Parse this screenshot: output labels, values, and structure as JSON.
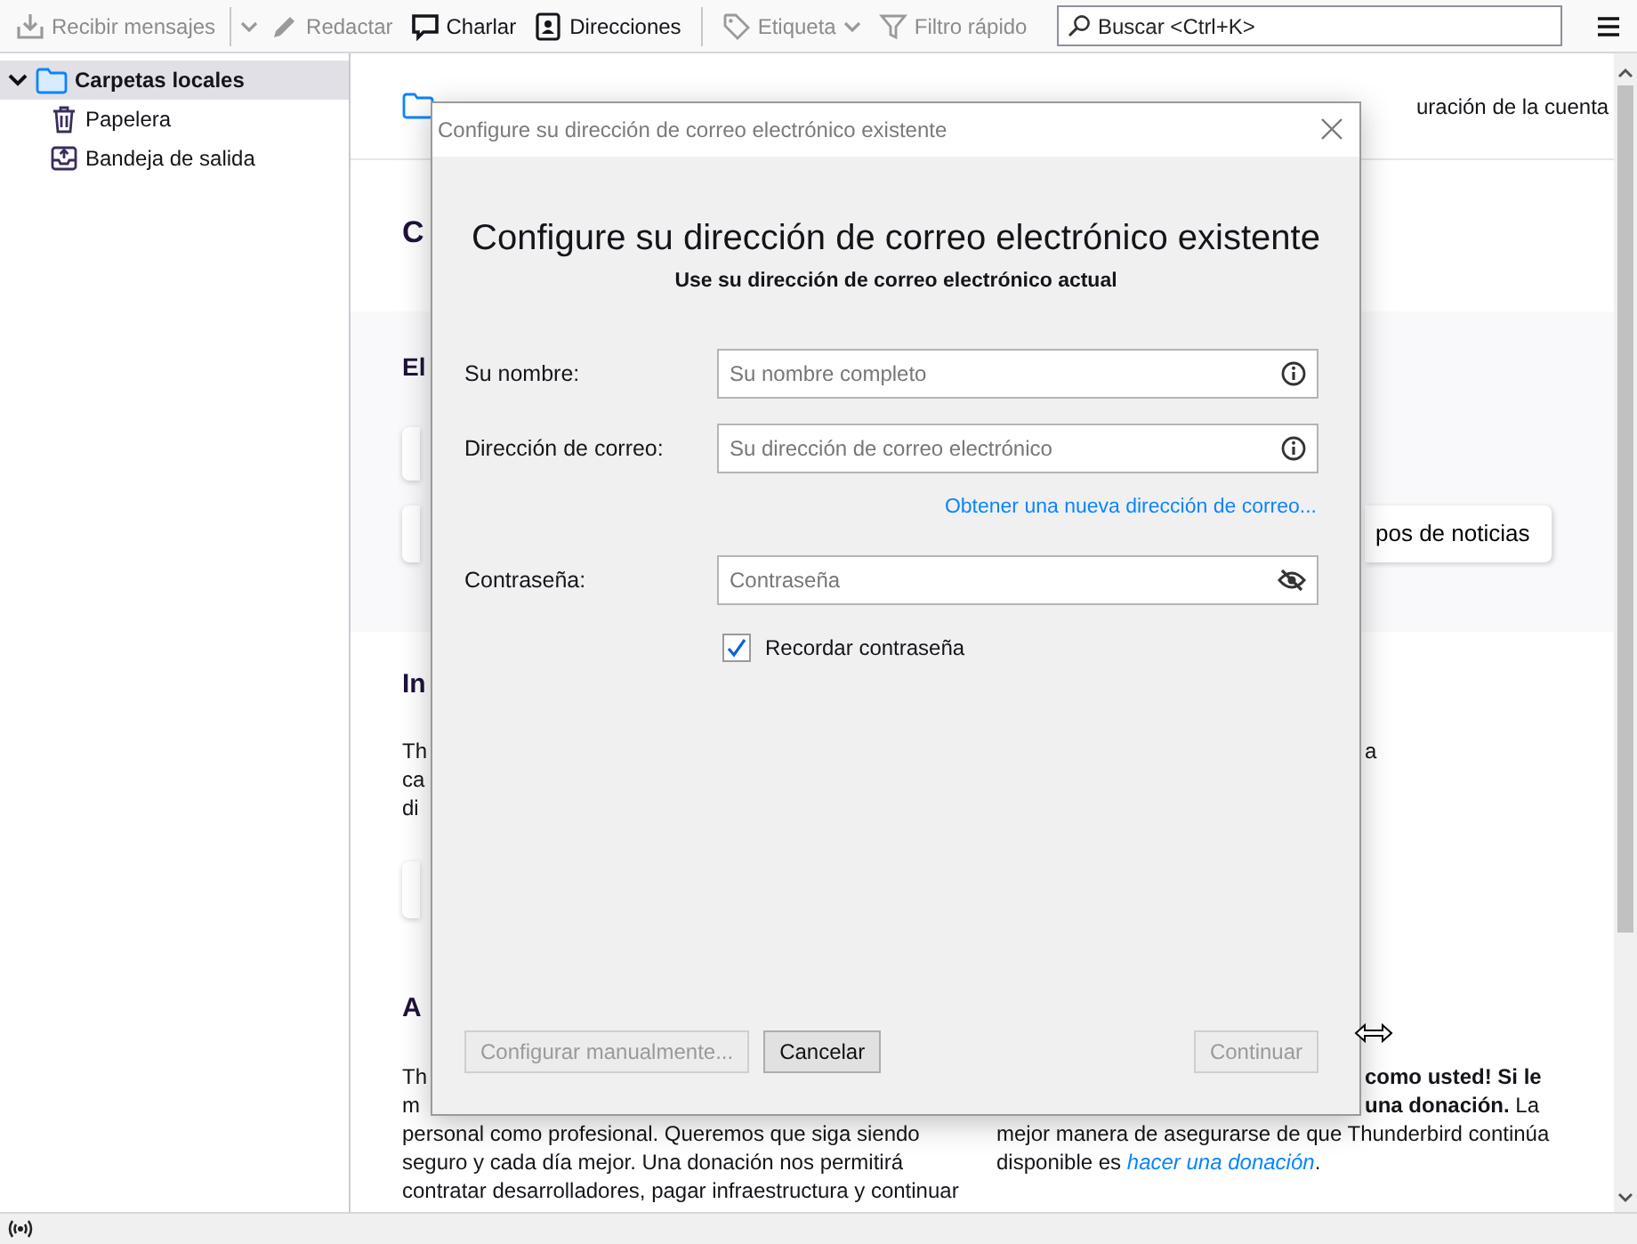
{
  "toolbar": {
    "items": [
      {
        "label": "Recibir mensajes",
        "disabled": true,
        "split_menu": true,
        "dropdown": false
      },
      {
        "label": "Redactar",
        "disabled": true,
        "split_menu": false,
        "dropdown": false
      },
      {
        "label": "Charlar",
        "disabled": false,
        "split_menu": false,
        "dropdown": false
      },
      {
        "label": "Direcciones",
        "disabled": false,
        "split_menu": false,
        "dropdown": false
      },
      {
        "label": "Etiqueta",
        "disabled": true,
        "split_menu": false,
        "dropdown": true
      },
      {
        "label": "Filtro rápido",
        "disabled": true,
        "split_menu": false,
        "dropdown": false
      }
    ],
    "search": {
      "placeholder": "Buscar <Ctrl+K>"
    }
  },
  "sidebar": {
    "items": [
      {
        "label": "Carpetas locales",
        "selected": true,
        "expanded": true,
        "children": [
          {
            "label": "Papelera",
            "selected": false
          },
          {
            "label": "Bandeja de salida",
            "selected": false
          }
        ]
      }
    ]
  },
  "main": {
    "header": {
      "settings_text": "uración de la cuenta"
    },
    "title_fragment": "C",
    "setup": {
      "heading": "El",
      "newsgroups_button": "pos de noticias"
    },
    "import": {
      "heading": "In",
      "lines": [
        {
          "left": "Th",
          "right": "a",
          "bold": false,
          "clipped": true
        },
        {
          "left": "ca"
        },
        {
          "left": "di"
        }
      ]
    },
    "about": {
      "heading": "A",
      "lines": [
        {
          "left": "Th",
          "right": "como usted! Si le",
          "bold": true,
          "clipped": true
        },
        {
          "left": "m",
          "right": "**una donación.** La",
          "bold": false,
          "clipped": true
        },
        {
          "left": "personal como profesional. Queremos que siga siendo",
          "right": "mejor manera de asegurarse de que Thunderbird continúa",
          "bold": false,
          "clipped": false
        },
        {
          "left": "seguro y cada día mejor. Una donación nos permitirá",
          "right": "disponible es ",
          "link": "hacer una donación",
          "after": ".",
          "bold": false,
          "clipped": false
        },
        {
          "left": "contratar desarrolladores, pagar infraestructura y continuar"
        }
      ]
    }
  },
  "dialog": {
    "title": "Configure su dirección de correo electrónico existente",
    "heading": "Configure su dirección de correo electrónico existente",
    "subheading": "Use su dirección de correo electrónico actual",
    "fields": [
      {
        "label": "Su nombre:",
        "placeholder": "Su nombre completo",
        "kind": "info"
      },
      {
        "label": "Dirección de correo:",
        "placeholder": "Su dirección de correo electrónico",
        "kind": "info"
      },
      {
        "label": "Contraseña:",
        "placeholder": "Contraseña",
        "kind": "password"
      }
    ],
    "link": {
      "label": "Obtener una nueva dirección de correo..."
    },
    "remember": {
      "label": "Recordar contraseña",
      "checked": true
    },
    "buttons": [
      {
        "label": "Configurar manualmente...",
        "disabled": true,
        "kind": "left"
      },
      {
        "label": "Cancelar",
        "disabled": false,
        "kind": "left"
      },
      {
        "label": "Continuar",
        "disabled": true,
        "kind": "right"
      }
    ]
  }
}
